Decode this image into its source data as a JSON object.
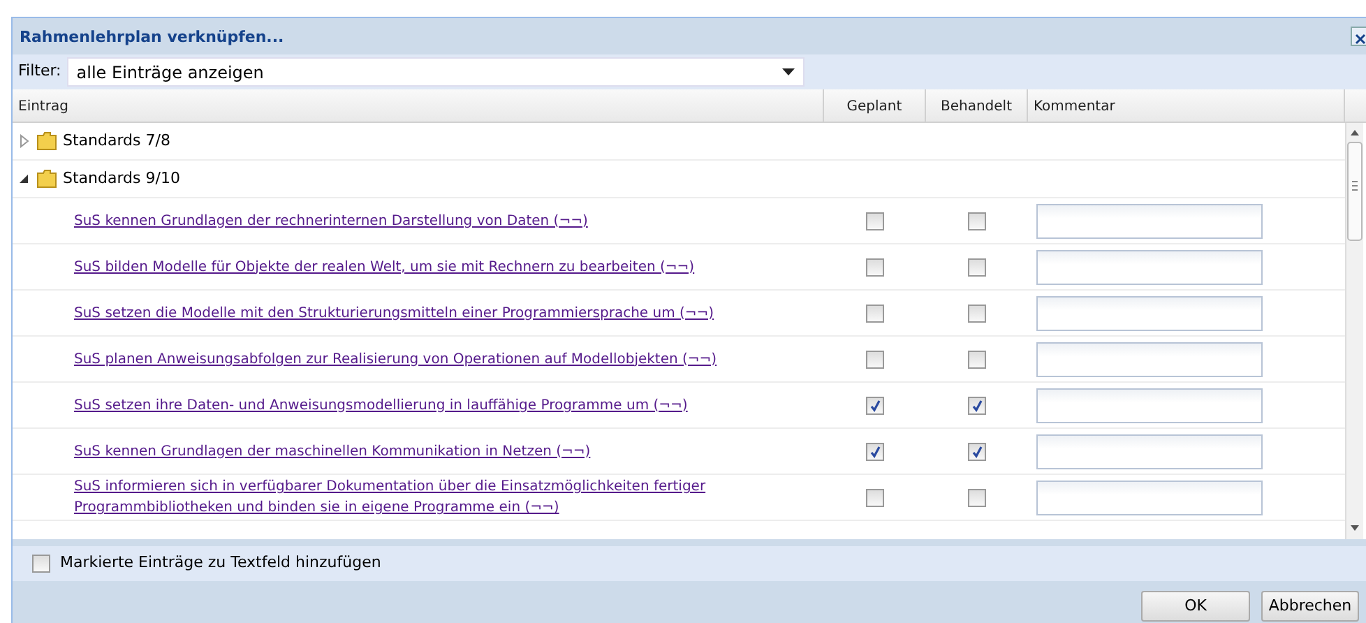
{
  "window": {
    "title": "Rahmenlehrplan verknüpfen..."
  },
  "filter": {
    "label": "Filter:",
    "value": "alle Einträge anzeigen"
  },
  "table": {
    "columns": [
      "Eintrag",
      "Geplant",
      "Behandelt",
      "Kommentar"
    ],
    "tree": [
      {
        "label": "Standards 7/8",
        "expanded": false
      },
      {
        "label": "Standards 9/10",
        "expanded": true,
        "children": [
          {
            "text": "SuS kennen Grundlagen der rechnerinternen Darstellung von Daten (¬¬)",
            "planned": false,
            "treated": false
          },
          {
            "text": "SuS bilden Modelle für Objekte der realen Welt, um sie mit Rechnern zu bearbeiten (¬¬)",
            "planned": false,
            "treated": false
          },
          {
            "text": "SuS setzen die Modelle mit den Strukturierungsmitteln einer Programmiersprache um (¬¬)",
            "planned": false,
            "treated": false
          },
          {
            "text": "SuS planen Anweisungsabfolgen zur Realisierung von Operationen auf Modellobjekten (¬¬)",
            "planned": false,
            "treated": false
          },
          {
            "text": "SuS setzen ihre Daten- und Anweisungsmodellierung in lauffähige Programme um (¬¬)",
            "planned": true,
            "treated": true
          },
          {
            "text": "SuS kennen Grundlagen der maschinellen Kommunikation in Netzen (¬¬)",
            "planned": true,
            "treated": true
          },
          {
            "text": "SuS informieren sich in verfügbarer Dokumentation über die Einsatzmöglichkeiten fertiger Programmbibliotheken und binden sie in eigene Programme ein (¬¬)",
            "planned": false,
            "treated": false
          }
        ]
      }
    ]
  },
  "add_to_textfield": {
    "label": "Markierte Einträge zu Textfeld hinzufügen",
    "checked": false
  },
  "buttons": [
    "OK",
    "Abbrechen"
  ]
}
